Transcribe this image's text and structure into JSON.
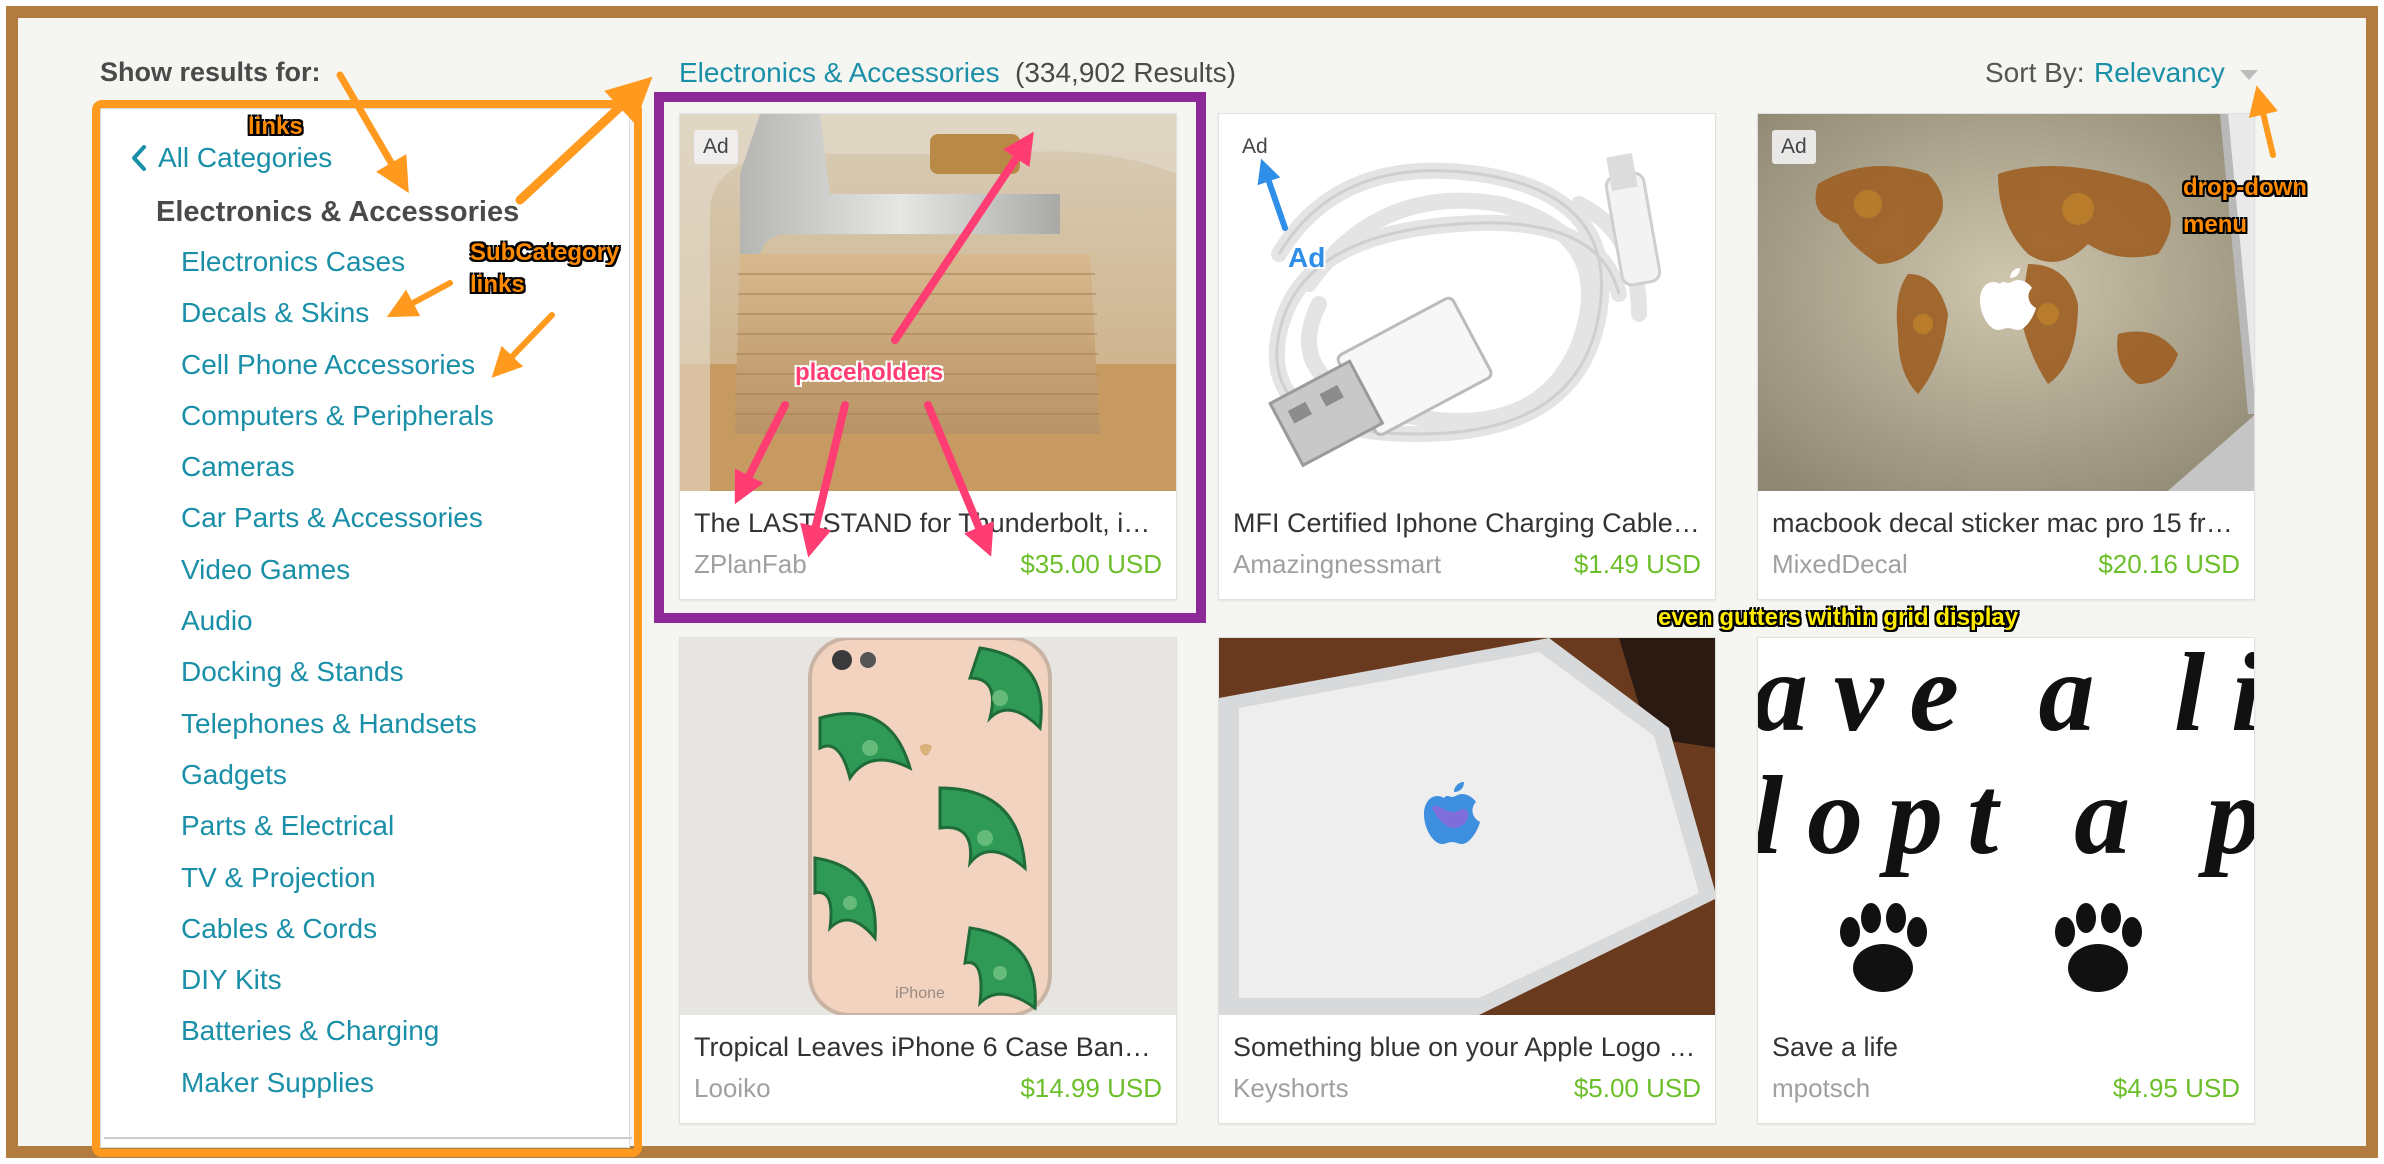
{
  "sidebar": {
    "show_label": "Show results for:",
    "all_categories": "All Categories",
    "current_category": "Electronics & Accessories",
    "subcategories": [
      "Electronics Cases",
      "Decals & Skins",
      "Cell Phone Accessories",
      "Computers & Peripherals",
      "Cameras",
      "Car Parts & Accessories",
      "Video Games",
      "Audio",
      "Docking & Stands",
      "Telephones & Handsets",
      "Gadgets",
      "Parts & Electrical",
      "TV & Projection",
      "Cables & Cords",
      "DIY Kits",
      "Batteries & Charging",
      "Maker Supplies"
    ]
  },
  "header": {
    "breadcrumb": "Electronics & Accessories",
    "results": "(334,902 Results)",
    "sort_label": "Sort By:",
    "sort_value": "Relevancy"
  },
  "products": [
    {
      "title": "The LAST STAND for Thunderbolt, i…",
      "seller": "ZPlanFab",
      "price": "$35.00 USD",
      "ad": "Ad"
    },
    {
      "title": "MFI Certified Iphone Charging Cable-…",
      "seller": "Amazingnessmart",
      "price": "$1.49 USD",
      "ad": "Ad"
    },
    {
      "title": "macbook decal sticker mac pro 15 fro…",
      "seller": "MixedDecal",
      "price": "$20.16 USD",
      "ad": "Ad"
    },
    {
      "title": "Tropical Leaves iPhone 6 Case Bana…",
      "seller": "Looiko",
      "price": "$14.99 USD",
      "phone_text": "iPhone"
    },
    {
      "title": "Something blue on your Apple Logo …",
      "seller": "Keyshorts",
      "price": "$5.00 USD"
    },
    {
      "title": "Save a life",
      "seller": "mpotsch",
      "price": "$4.95 USD",
      "image_text": [
        "ave a li",
        "lopt a p"
      ]
    }
  ],
  "annotations": {
    "links": "links",
    "subcategory_links": [
      "SubCategory",
      "links"
    ],
    "placeholders": "placeholders",
    "ad": "Ad",
    "dropdown": [
      "drop-down",
      "menu"
    ],
    "gutters": "even gutters within grid display"
  },
  "colors": {
    "link": "#1a8fa8",
    "price": "#6cbf2a",
    "frame": "#b07d3e",
    "highlight_orange": "#ff9a1f",
    "highlight_purple": "#8e2a97",
    "arrow_pink": "#ff3d73",
    "arrow_blue": "#2f8ee8"
  }
}
